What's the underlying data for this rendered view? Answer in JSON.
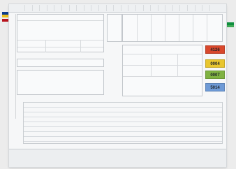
{
  "colors": {
    "tab_blue": "#0c3c8c",
    "tab_yellow": "#ecc01a",
    "tab_red": "#b8131c",
    "tab_green": "#0f8f3e"
  },
  "badges": [
    {
      "code": "4126",
      "color": "#d9482c"
    },
    {
      "code": "0004",
      "color": "#e9c62e"
    },
    {
      "code": "0007",
      "color": "#7fb241"
    },
    {
      "code": "5014",
      "color": "#6e9ad6"
    }
  ]
}
